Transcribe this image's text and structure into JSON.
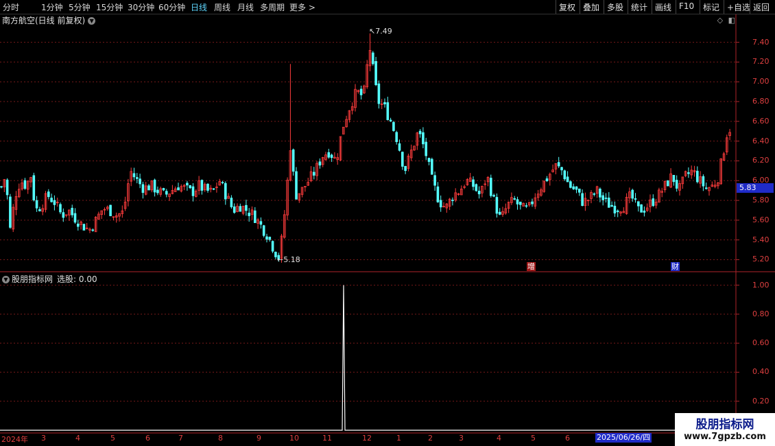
{
  "toolbar": {
    "periods": [
      "分时",
      "1分钟",
      "5分钟",
      "15分钟",
      "30分钟",
      "60分钟",
      "日线",
      "周线",
      "月线",
      "多周期",
      "更多 >"
    ],
    "active_period": "日线",
    "right_buttons": [
      "复权",
      "叠加",
      "多股",
      "统计",
      "画线",
      "F10",
      "标记",
      "+自选",
      "返回"
    ]
  },
  "chart_title": "南方航空(日线 前复权)",
  "indicator_title": "股朋指标网",
  "indicator_value": "选股: 0.00",
  "current_price": "5.83",
  "high_label": "7.49",
  "low_label": "5.18",
  "badges": {
    "zeng": "增",
    "cai": "财"
  },
  "date_axis": {
    "year": "2024年",
    "months": [
      "3",
      "4",
      "5",
      "6",
      "7",
      "8",
      "9",
      "10",
      "11",
      "12",
      "1",
      "2",
      "3",
      "4",
      "5",
      "6"
    ],
    "cursor": "2025/06/26/四"
  },
  "watermark": {
    "title": "股朋指标网",
    "url": "www.7gpzb.com"
  },
  "colors": {
    "up": "#ff3c3c",
    "down": "#54ffff",
    "axis": "#b0242a",
    "grid": "#7a1a1a",
    "cursor": "#1f2bc8"
  },
  "chart_data": [
    {
      "type": "candlestick",
      "title": "南方航空(日线 前复权)",
      "yticks": [
        5.2,
        5.4,
        5.6,
        5.8,
        6.0,
        6.2,
        6.4,
        6.6,
        6.8,
        7.0,
        7.2,
        7.4
      ],
      "ylim": [
        5.12,
        7.55
      ],
      "high": 7.49,
      "low": 5.18,
      "last": 5.83,
      "close_path": [
        [
          0,
          5.9
        ],
        [
          8,
          6.05
        ],
        [
          15,
          5.5
        ],
        [
          22,
          5.85
        ],
        [
          30,
          6.0
        ],
        [
          38,
          5.95
        ],
        [
          45,
          6.05
        ],
        [
          52,
          5.7
        ],
        [
          60,
          5.75
        ],
        [
          70,
          5.85
        ],
        [
          80,
          5.78
        ],
        [
          90,
          5.65
        ],
        [
          100,
          5.7
        ],
        [
          110,
          5.62
        ],
        [
          120,
          5.55
        ],
        [
          130,
          5.5
        ],
        [
          140,
          5.6
        ],
        [
          150,
          5.72
        ],
        [
          160,
          5.7
        ],
        [
          170,
          5.65
        ],
        [
          180,
          5.68
        ],
        [
          190,
          6.1
        ],
        [
          200,
          6.0
        ],
        [
          210,
          5.92
        ],
        [
          220,
          5.95
        ],
        [
          230,
          5.9
        ],
        [
          240,
          5.85
        ],
        [
          250,
          5.9
        ],
        [
          260,
          5.95
        ],
        [
          270,
          5.92
        ],
        [
          280,
          5.88
        ],
        [
          290,
          5.95
        ],
        [
          300,
          5.9
        ],
        [
          310,
          5.88
        ],
        [
          320,
          6.0
        ],
        [
          330,
          5.85
        ],
        [
          340,
          5.7
        ],
        [
          350,
          5.75
        ],
        [
          360,
          5.7
        ],
        [
          370,
          5.65
        ],
        [
          380,
          5.55
        ],
        [
          390,
          5.45
        ],
        [
          400,
          5.3
        ],
        [
          406,
          5.22
        ],
        [
          412,
          5.45
        ],
        [
          418,
          5.9
        ],
        [
          424,
          6.4
        ],
        [
          430,
          5.85
        ],
        [
          440,
          5.9
        ],
        [
          450,
          6.0
        ],
        [
          460,
          6.1
        ],
        [
          470,
          6.25
        ],
        [
          480,
          6.3
        ],
        [
          490,
          6.2
        ],
        [
          500,
          6.55
        ],
        [
          510,
          6.75
        ],
        [
          520,
          6.9
        ],
        [
          530,
          6.85
        ],
        [
          536,
          7.2
        ],
        [
          540,
          7.35
        ],
        [
          546,
          7.0
        ],
        [
          552,
          6.8
        ],
        [
          560,
          6.75
        ],
        [
          570,
          6.6
        ],
        [
          580,
          6.4
        ],
        [
          590,
          6.1
        ],
        [
          600,
          6.3
        ],
        [
          610,
          6.5
        ],
        [
          620,
          6.3
        ],
        [
          630,
          6.0
        ],
        [
          640,
          5.8
        ],
        [
          650,
          5.72
        ],
        [
          660,
          5.85
        ],
        [
          670,
          5.9
        ],
        [
          680,
          6.0
        ],
        [
          690,
          5.95
        ],
        [
          700,
          5.85
        ],
        [
          710,
          6.05
        ],
        [
          720,
          5.8
        ],
        [
          730,
          5.6
        ],
        [
          740,
          5.75
        ],
        [
          750,
          5.8
        ],
        [
          760,
          5.72
        ],
        [
          770,
          5.7
        ],
        [
          780,
          5.85
        ],
        [
          790,
          5.95
        ],
        [
          800,
          6.05
        ],
        [
          810,
          6.15
        ],
        [
          820,
          6.1
        ],
        [
          830,
          5.95
        ],
        [
          840,
          5.9
        ],
        [
          850,
          5.78
        ],
        [
          860,
          5.82
        ],
        [
          870,
          5.9
        ],
        [
          880,
          5.8
        ],
        [
          890,
          5.75
        ],
        [
          900,
          5.72
        ],
        [
          910,
          5.75
        ],
        [
          920,
          5.85
        ],
        [
          930,
          5.7
        ],
        [
          940,
          5.72
        ],
        [
          950,
          5.78
        ],
        [
          960,
          5.85
        ],
        [
          970,
          5.95
        ],
        [
          980,
          6.05
        ],
        [
          990,
          5.9
        ],
        [
          1000,
          6.05
        ],
        [
          1010,
          6.1
        ],
        [
          1020,
          6.0
        ],
        [
          1030,
          5.92
        ],
        [
          1040,
          5.95
        ],
        [
          1048,
          6.05
        ],
        [
          1055,
          6.3
        ],
        [
          1062,
          6.55
        ],
        [
          1066,
          6.5
        ]
      ]
    },
    {
      "type": "line",
      "title": "股朋指标网",
      "series": [
        {
          "name": "选股",
          "spikes": [
            {
              "x_index": 1,
              "value": 1.0
            }
          ],
          "baseline": 0.0
        }
      ],
      "yticks": [
        0.2,
        0.4,
        0.6,
        0.8,
        1.0
      ],
      "ylim": [
        0.0,
        1.05
      ]
    }
  ]
}
